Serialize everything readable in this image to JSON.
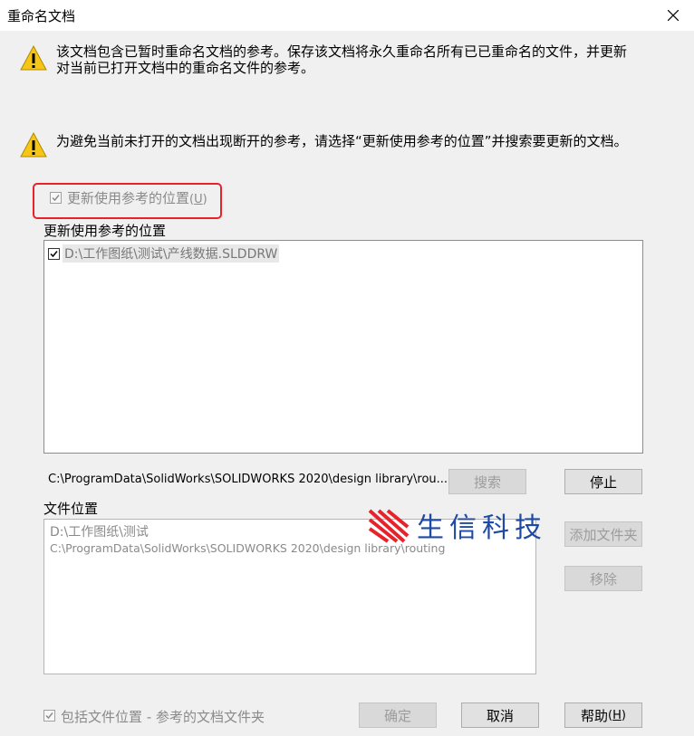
{
  "window": {
    "title": "重命名文档",
    "close_icon": "close-icon"
  },
  "messages": {
    "first_line1": "该文档包含已暂时重命名文档的参考。保存该文档将永久重命名所有已已重命名的文件，并更新",
    "first_line2": "对当前已打开文档中的重命名文件的参考。",
    "second": "为避免当前未打开的文档出现断开的参考，请选择“更新使用参考的位置”并搜索要更新的文档。"
  },
  "update_option": {
    "label": "更新使用参考的位置",
    "shortcut": "U",
    "checked": true
  },
  "references": {
    "header": "更新使用参考的位置",
    "items": [
      {
        "text": "D:\\工作图纸\\测试\\产线数据.SLDDRW",
        "checked": true
      }
    ]
  },
  "search": {
    "status_path": "C:\\ProgramData\\SolidWorks\\SOLIDWORKS 2020\\design library\\rou...",
    "search_button": "搜索",
    "stop_button": "停止"
  },
  "file_locations": {
    "header": "文件位置",
    "items": [
      "D:\\工作图纸\\测试",
      "C:\\ProgramData\\SolidWorks\\SOLIDWORKS 2020\\design library\\routing"
    ],
    "add_button": "添加文件夹",
    "remove_button": "移除"
  },
  "include_option": {
    "label": "包括文件位置 - 参考的文档文件夹",
    "checked": true
  },
  "footer": {
    "ok": "确定",
    "cancel": "取消",
    "help": "帮助",
    "help_shortcut": "H"
  },
  "watermark": {
    "text": "生信科技",
    "color": "#1e4aa6",
    "accent": "#e8212a"
  },
  "colors": {
    "highlight": "#e8212a",
    "warning": "#f5c518"
  }
}
